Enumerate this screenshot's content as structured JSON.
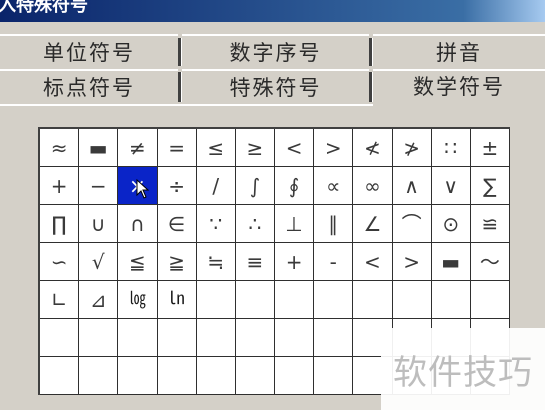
{
  "window": {
    "title": "入特殊符号"
  },
  "tabs": [
    {
      "label": "单位符号",
      "active": false
    },
    {
      "label": "数字序号",
      "active": false
    },
    {
      "label": "拼音",
      "active": false
    },
    {
      "label": "标点符号",
      "active": false
    },
    {
      "label": "特殊符号",
      "active": false
    },
    {
      "label": "数学符号",
      "active": true
    }
  ],
  "grid": {
    "columns": 12,
    "rows": 7,
    "selected_index": 14,
    "symbols": [
      "≈",
      "▬",
      "≠",
      "=",
      "≤",
      "≥",
      "<",
      ">",
      "≮",
      "≯",
      "∷",
      "±",
      "+",
      "−",
      "×",
      "÷",
      "/",
      "∫",
      "∮",
      "∝",
      "∞",
      "∧",
      "∨",
      "∑",
      "∏",
      "∪",
      "∩",
      "∈",
      "∵",
      "∴",
      "⊥",
      "∥",
      "∠",
      "⌒",
      "⊙",
      "≌",
      "∽",
      "√",
      "≦",
      "≧",
      "≒",
      "≡",
      "+",
      "-",
      "<",
      ">",
      "▬",
      "～",
      "∟",
      "⊿",
      "㏒",
      "㏑",
      "",
      "",
      "",
      "",
      "",
      "",
      "",
      "",
      "",
      "",
      "",
      "",
      "",
      "",
      "",
      "",
      "",
      "",
      "",
      "",
      "",
      "",
      "",
      "",
      "",
      "",
      "",
      "",
      "",
      "",
      "",
      ""
    ]
  },
  "watermark": {
    "text": "软件技巧"
  },
  "colors": {
    "title_bar": "#0a246a",
    "selection": "#0a24c8",
    "panel": "#d4d0c8"
  }
}
